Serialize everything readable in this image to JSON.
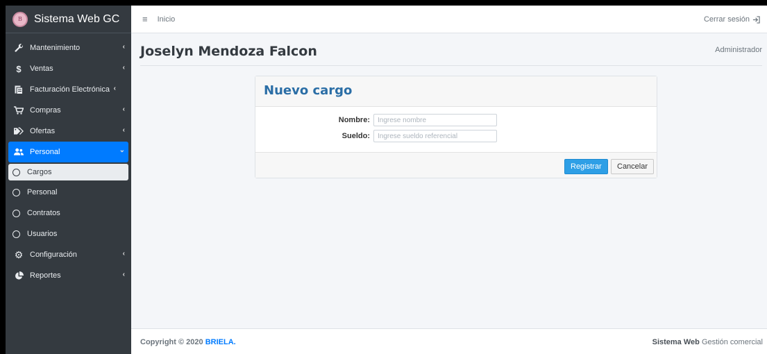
{
  "brand": {
    "logo_text": "Briela",
    "name": "Sistema Web GC"
  },
  "topbar": {
    "menu_icon": "≡",
    "breadcrumb": "Inicio",
    "logout_label": "Cerrar sesión"
  },
  "sidebar": {
    "items": [
      {
        "label": "Mantenimiento",
        "icon": "wrench-icon"
      },
      {
        "label": "Ventas",
        "icon": "dollar-icon"
      },
      {
        "label": "Facturación Electrónica",
        "icon": "invoice-icon"
      },
      {
        "label": "Compras",
        "icon": "cart-icon"
      },
      {
        "label": "Ofertas",
        "icon": "tags-icon"
      },
      {
        "label": "Personal",
        "icon": "users-icon",
        "expanded": true,
        "children": [
          "Cargos",
          "Personal",
          "Contratos",
          "Usuarios"
        ],
        "current": "Cargos"
      },
      {
        "label": "Configuración",
        "icon": "gear-icon"
      },
      {
        "label": "Reportes",
        "icon": "pie-chart-icon"
      }
    ]
  },
  "header": {
    "user_name": "Joselyn Mendoza Falcon",
    "role": "Administrador"
  },
  "form": {
    "title": "Nuevo cargo",
    "nombre_label": "Nombre:",
    "nombre_placeholder": "Ingrese nombre",
    "sueldo_label": "Sueldo:",
    "sueldo_placeholder": "Ingrese sueldo referencial",
    "submit_label": "Registrar",
    "cancel_label": "Cancelar"
  },
  "footer": {
    "copyright": "Copyright © 2020",
    "company": "BRIELA.",
    "system_bold": "Sistema Web",
    "system_rest": "Gestión comercial"
  },
  "colors": {
    "sidebar": "#343a40",
    "accent": "#007bff",
    "primary_button": "#2e9fe6",
    "title": "#2b6ea6"
  }
}
